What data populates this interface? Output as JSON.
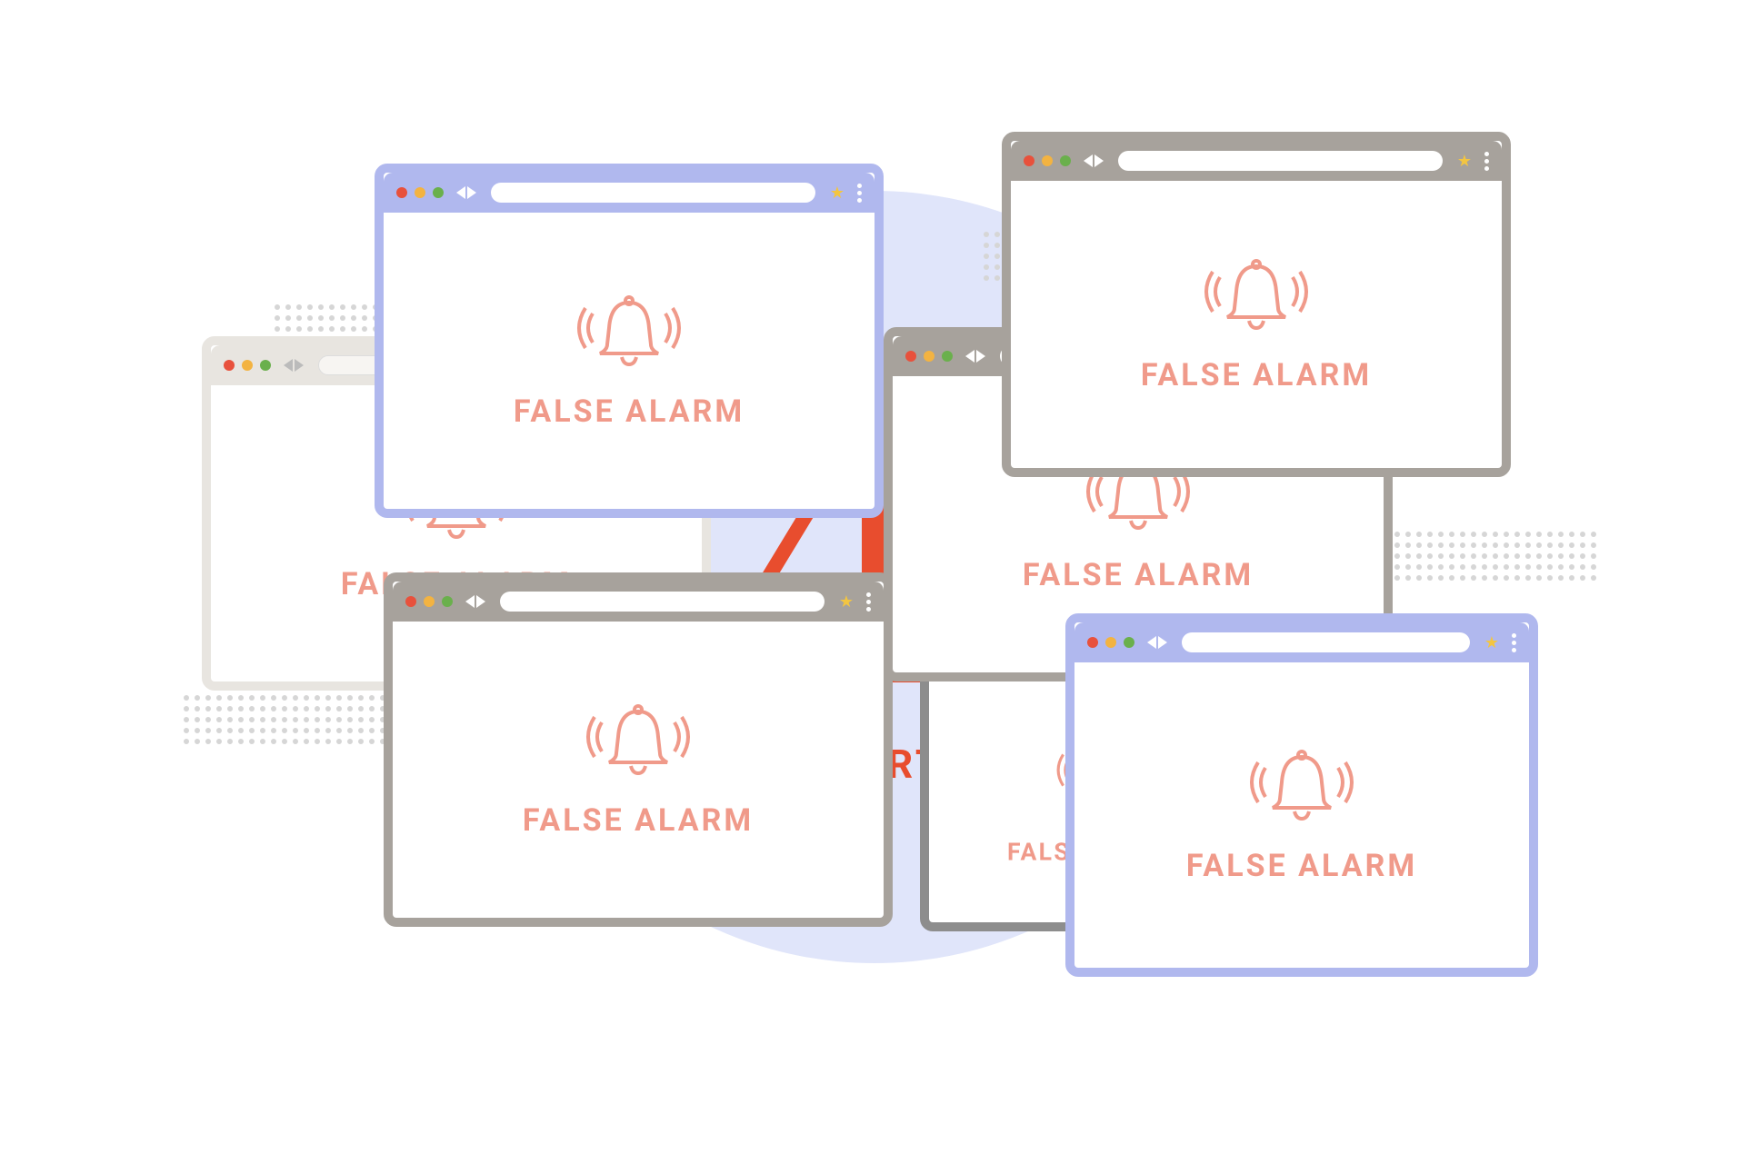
{
  "center": {
    "alert_label": "ALERT"
  },
  "windows": {
    "w1": {
      "label": "FALSE ALARM",
      "theme": "purple"
    },
    "w2": {
      "label": "FALSE ALARM",
      "theme": "light"
    },
    "w3": {
      "label": "FALSE ALARM",
      "theme": "grey"
    },
    "w4": {
      "label": "FALSE ALARM",
      "theme": "grey"
    },
    "w5": {
      "label": "FALSE ALARM",
      "theme": "grey"
    },
    "w6": {
      "label": "FALSE ALARM",
      "theme": "darkgrey"
    },
    "w7": {
      "label": "FALSE ALARM",
      "theme": "purple"
    }
  },
  "colors": {
    "accent_red": "#e84d2e",
    "false_text": "#f09a8a",
    "purple": "#b0b8ee",
    "grey": "#a7a29c",
    "lightgrey": "#e8e5e0",
    "darkgrey": "#8d8d8d",
    "bg_circle": "#e0e5fa"
  }
}
